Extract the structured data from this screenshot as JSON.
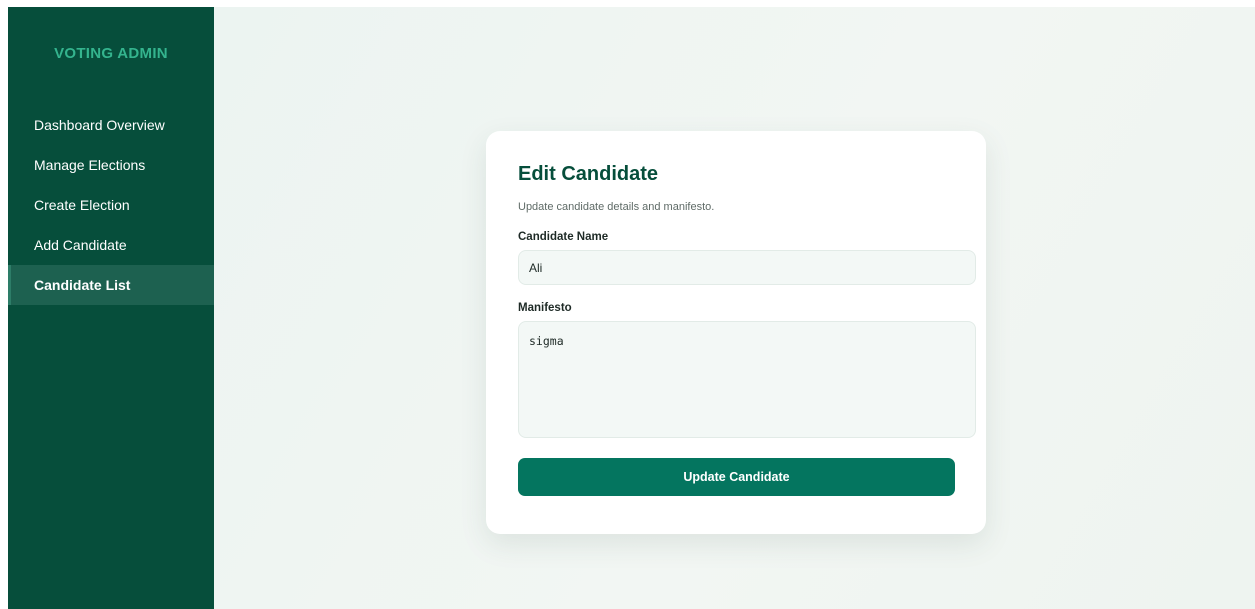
{
  "sidebar": {
    "brand": "VOTING ADMIN",
    "items": [
      {
        "label": "Dashboard Overview",
        "active": false
      },
      {
        "label": "Manage Elections",
        "active": false
      },
      {
        "label": "Create Election",
        "active": false
      },
      {
        "label": "Add Candidate",
        "active": false
      },
      {
        "label": "Candidate List",
        "active": true
      }
    ]
  },
  "form": {
    "title": "Edit Candidate",
    "subtitle": "Update candidate details and manifesto.",
    "name_label": "Candidate Name",
    "name_value": "Ali",
    "manifesto_label": "Manifesto",
    "manifesto_value": "sigma",
    "submit_label": "Update Candidate"
  },
  "colors": {
    "sidebar_bg": "#064e3b",
    "brand_text": "#34b48e",
    "active_item_bg": "#1d6150",
    "title_text": "#064e3b",
    "button_bg": "#04755f"
  }
}
